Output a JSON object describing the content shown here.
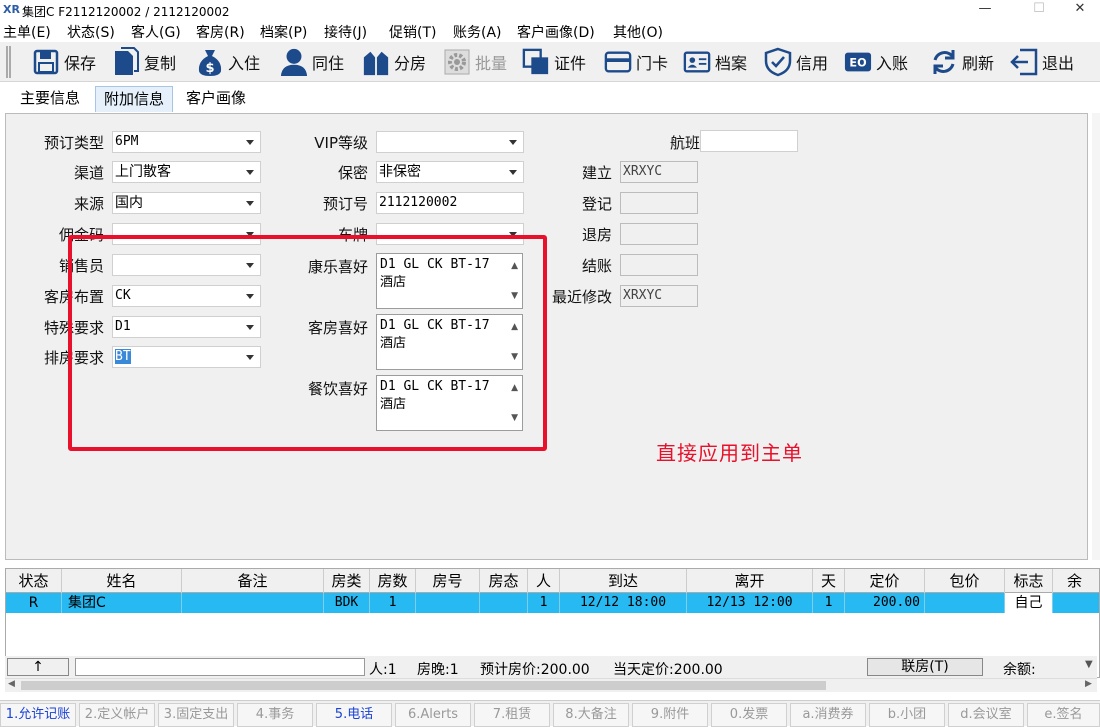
{
  "window": {
    "title": "集团C  F2112120002  /  2112120002",
    "logo": "XR",
    "controls": [
      "—",
      "☐",
      "✕"
    ]
  },
  "menubar": [
    "主单(E)",
    "状态(S)",
    "客人(G)",
    "客房(R)",
    "档案(P)",
    "接待(J)",
    "促销(T)",
    "账务(A)",
    "客户画像(D)",
    "其他(O)"
  ],
  "toolbar": {
    "items": [
      {
        "label": "保存",
        "icon": "floppy-disk-icon"
      },
      {
        "label": "复制",
        "icon": "copy-document-icon"
      },
      {
        "label": "入住",
        "icon": "money-bag-icon"
      },
      {
        "label": "同住",
        "icon": "person-icon"
      },
      {
        "label": "分房",
        "icon": "buildings-icon"
      },
      {
        "label": "批量",
        "icon": "gear-icon",
        "disabled": true
      },
      {
        "label": "证件",
        "icon": "id-cards-icon"
      },
      {
        "label": "门卡",
        "icon": "door-card-icon"
      },
      {
        "label": "档案",
        "icon": "profile-card-icon"
      },
      {
        "label": "信用",
        "icon": "shield-check-icon"
      },
      {
        "label": "入账",
        "icon": "post-charge-icon"
      },
      {
        "label": "刷新",
        "icon": "refresh-icon"
      },
      {
        "label": "退出",
        "icon": "exit-icon"
      }
    ]
  },
  "tabs": [
    "主要信息",
    "附加信息",
    "客户画像"
  ],
  "active_tab": "附加信息",
  "form": {
    "col1": [
      {
        "label": "预订类型",
        "value": "6PM"
      },
      {
        "label": "渠道",
        "value": "上门散客"
      },
      {
        "label": "来源",
        "value": "国内"
      },
      {
        "label": "佣金码",
        "value": ""
      },
      {
        "label": "销售员",
        "value": ""
      },
      {
        "label": "客房布置",
        "value": "CK"
      },
      {
        "label": "特殊要求",
        "value": "D1"
      },
      {
        "label": "排房要求",
        "value": "BT"
      }
    ],
    "col2": [
      {
        "label": "VIP等级",
        "value": ""
      },
      {
        "label": "保密",
        "value": "非保密"
      },
      {
        "label": "预订号",
        "value": "2112120002"
      },
      {
        "label": "车牌",
        "value": ""
      }
    ],
    "memos": [
      {
        "label": "康乐喜好",
        "value": "D1 GL CK BT-17\n酒店"
      },
      {
        "label": "客房喜好",
        "value": "D1 GL CK BT-17\n酒店"
      },
      {
        "label": "餐饮喜好",
        "value": "D1 GL CK BT-17\n酒店"
      }
    ],
    "col3": [
      {
        "label": "航班",
        "value": ""
      },
      {
        "label": "建立",
        "value": "XRXYC"
      },
      {
        "label": "登记",
        "value": ""
      },
      {
        "label": "退房",
        "value": ""
      },
      {
        "label": "结账",
        "value": ""
      },
      {
        "label": "最近修改",
        "value": "XRXYC"
      }
    ]
  },
  "annotation": {
    "text": "直接应用到主单",
    "color": "#e8102a"
  },
  "grid": {
    "columns": [
      "状态",
      "姓名",
      "备注",
      "房类",
      "房数",
      "房号",
      "房态",
      "人",
      "到达",
      "离开",
      "天",
      "定价",
      "包价",
      "标志",
      "余"
    ],
    "rows": [
      [
        "R",
        "集团C",
        "",
        "BDK",
        "1",
        "",
        "",
        "1",
        "12/12 18:00",
        "12/13 12:00",
        "1",
        "200.00",
        "",
        "自己",
        ""
      ]
    ]
  },
  "summary": {
    "arrow": "↑",
    "people": "人:1",
    "room_nights": "房晚:1",
    "est_rate": "预计房价:200.00",
    "day_rate": "当天定价:200.00",
    "link_button": "联房(T)",
    "balance_label": "余额:"
  },
  "bottom_tabs": [
    "1.允许记账",
    "2.定义帐户",
    "3.固定支出",
    "4.事务",
    "5.电话",
    "6.Alerts",
    "7.租赁",
    "8.大备注",
    "9.附件",
    "0.发票",
    "a.消费券",
    "b.小团",
    "d.会议室",
    "e.签名"
  ],
  "bottom_tabs_active": [
    "1.允许记账",
    "5.电话"
  ],
  "colors": {
    "grid_selected": "#27b9f2",
    "tab_active": "#e5f0fb",
    "highlight": "#3a88d8"
  }
}
